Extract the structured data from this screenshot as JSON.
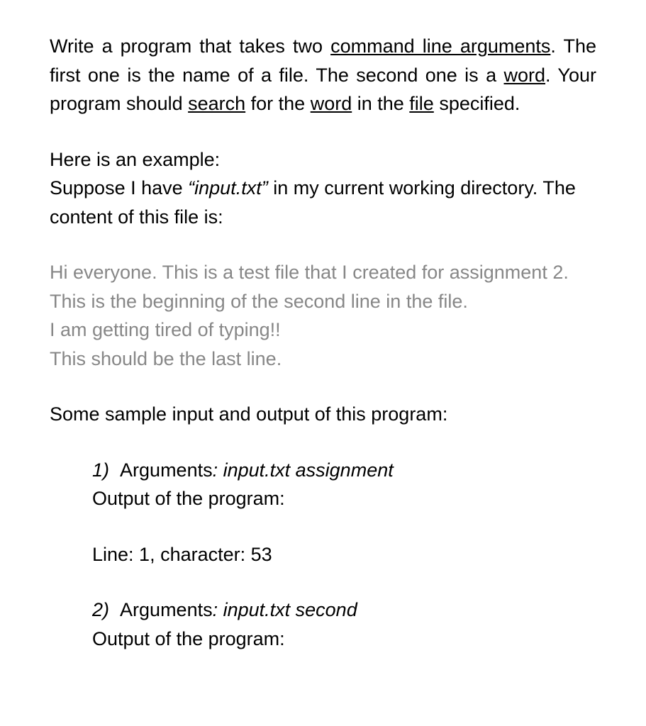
{
  "intro": {
    "p1_a": "Write a program that takes two ",
    "p1_u1": "command line arguments",
    "p1_b": ". The first one is the name of a file. The second one is a ",
    "p1_u2": "word",
    "p1_c": ". Your program should ",
    "p1_u3": "search",
    "p1_d": " for the ",
    "p1_u4": "word",
    "p1_e": " in the ",
    "p1_u5": "file",
    "p1_f": " specified."
  },
  "example": {
    "line1": "Here is an example:",
    "line2a": "Suppose I have ",
    "line2_italic": "“input.txt”",
    "line2b": " in my current working directory. The content of this file is:"
  },
  "file_content": [
    "Hi everyone. This is a test file that I created for assignment 2.",
    "This is the beginning of the second line in the file.",
    "I am getting tired of typing!!",
    "This should be the last line."
  ],
  "samples_intro": "Some sample input and output of this program:",
  "samples": [
    {
      "num": "1)",
      "args_label": "Arguments",
      "args_value": ": input.txt assignment",
      "output_label": "Output of the program:",
      "output_value": "Line: 1, character: 53"
    },
    {
      "num": "2)",
      "args_label": "Arguments",
      "args_value": ": input.txt second",
      "output_label": "Output of the program:",
      "output_value": ""
    }
  ]
}
